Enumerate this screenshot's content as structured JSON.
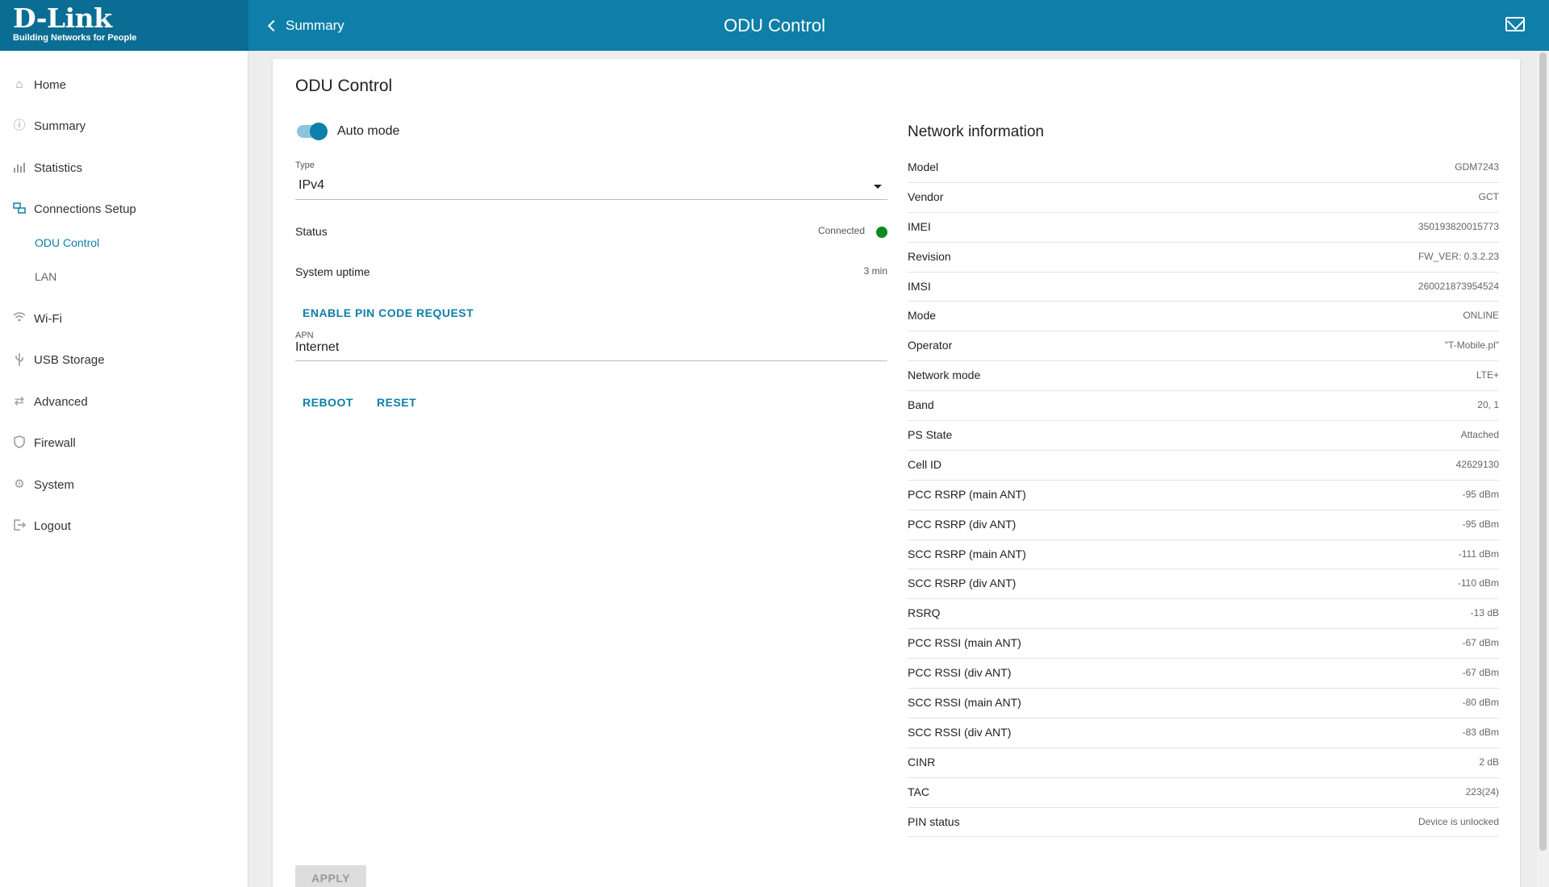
{
  "brand": {
    "name": "D-Link",
    "tagline": "Building Networks for People"
  },
  "header": {
    "back_label": "Summary",
    "title": "ODU Control"
  },
  "sidebar": {
    "items": [
      {
        "label": "Home",
        "icon": "home-icon"
      },
      {
        "label": "Summary",
        "icon": "info-icon"
      },
      {
        "label": "Statistics",
        "icon": "bar-chart-icon"
      },
      {
        "label": "Connections Setup",
        "icon": "connections-icon"
      },
      {
        "label": "Wi-Fi",
        "icon": "wifi-icon"
      },
      {
        "label": "USB Storage",
        "icon": "usb-icon"
      },
      {
        "label": "Advanced",
        "icon": "arrows-icon"
      },
      {
        "label": "Firewall",
        "icon": "shield-icon"
      },
      {
        "label": "System",
        "icon": "gear-icon"
      },
      {
        "label": "Logout",
        "icon": "logout-icon"
      }
    ],
    "sub_items": [
      {
        "label": "ODU Control",
        "active": true
      },
      {
        "label": "LAN",
        "active": false
      }
    ]
  },
  "main": {
    "title": "ODU Control",
    "auto_mode_label": "Auto mode",
    "auto_mode_on": true,
    "type_label": "Type",
    "type_value": "IPv4",
    "status_label": "Status",
    "status_value": "Connected",
    "uptime_label": "System uptime",
    "uptime_value": "3 min",
    "pin_button": "ENABLE PIN CODE REQUEST",
    "apn_label": "APN",
    "apn_value": "Internet",
    "reboot_button": "REBOOT",
    "reset_button": "RESET",
    "apply_button": "APPLY"
  },
  "network": {
    "title": "Network information",
    "rows": [
      {
        "key": "Model",
        "value": "GDM7243"
      },
      {
        "key": "Vendor",
        "value": "GCT"
      },
      {
        "key": "IMEI",
        "value": "350193820015773"
      },
      {
        "key": "Revision",
        "value": "FW_VER: 0.3.2.23"
      },
      {
        "key": "IMSI",
        "value": "260021873954524"
      },
      {
        "key": "Mode",
        "value": "ONLINE"
      },
      {
        "key": "Operator",
        "value": "\"T-Mobile.pl\""
      },
      {
        "key": "Network mode",
        "value": "LTE+"
      },
      {
        "key": "Band",
        "value": "20, 1"
      },
      {
        "key": "PS State",
        "value": "Attached"
      },
      {
        "key": "Cell ID",
        "value": "42629130"
      },
      {
        "key": "PCC RSRP (main ANT)",
        "value": "-95 dBm"
      },
      {
        "key": "PCC RSRP (div ANT)",
        "value": "-95 dBm"
      },
      {
        "key": "SCC RSRP (main ANT)",
        "value": "-111 dBm"
      },
      {
        "key": "SCC RSRP (div ANT)",
        "value": "-110 dBm"
      },
      {
        "key": "RSRQ",
        "value": "-13 dB"
      },
      {
        "key": "PCC RSSI (main ANT)",
        "value": "-67 dBm"
      },
      {
        "key": "PCC RSSI (div ANT)",
        "value": "-67 dBm"
      },
      {
        "key": "SCC RSSI (main ANT)",
        "value": "-80 dBm"
      },
      {
        "key": "SCC RSSI (div ANT)",
        "value": "-83 dBm"
      },
      {
        "key": "CINR",
        "value": "2 dB"
      },
      {
        "key": "TAC",
        "value": "223(24)"
      },
      {
        "key": "PIN status",
        "value": "Device is unlocked"
      }
    ]
  },
  "colors": {
    "header": "#0d7fa8",
    "accent": "#0d7fa8",
    "status_ok": "#0c8a1e"
  }
}
